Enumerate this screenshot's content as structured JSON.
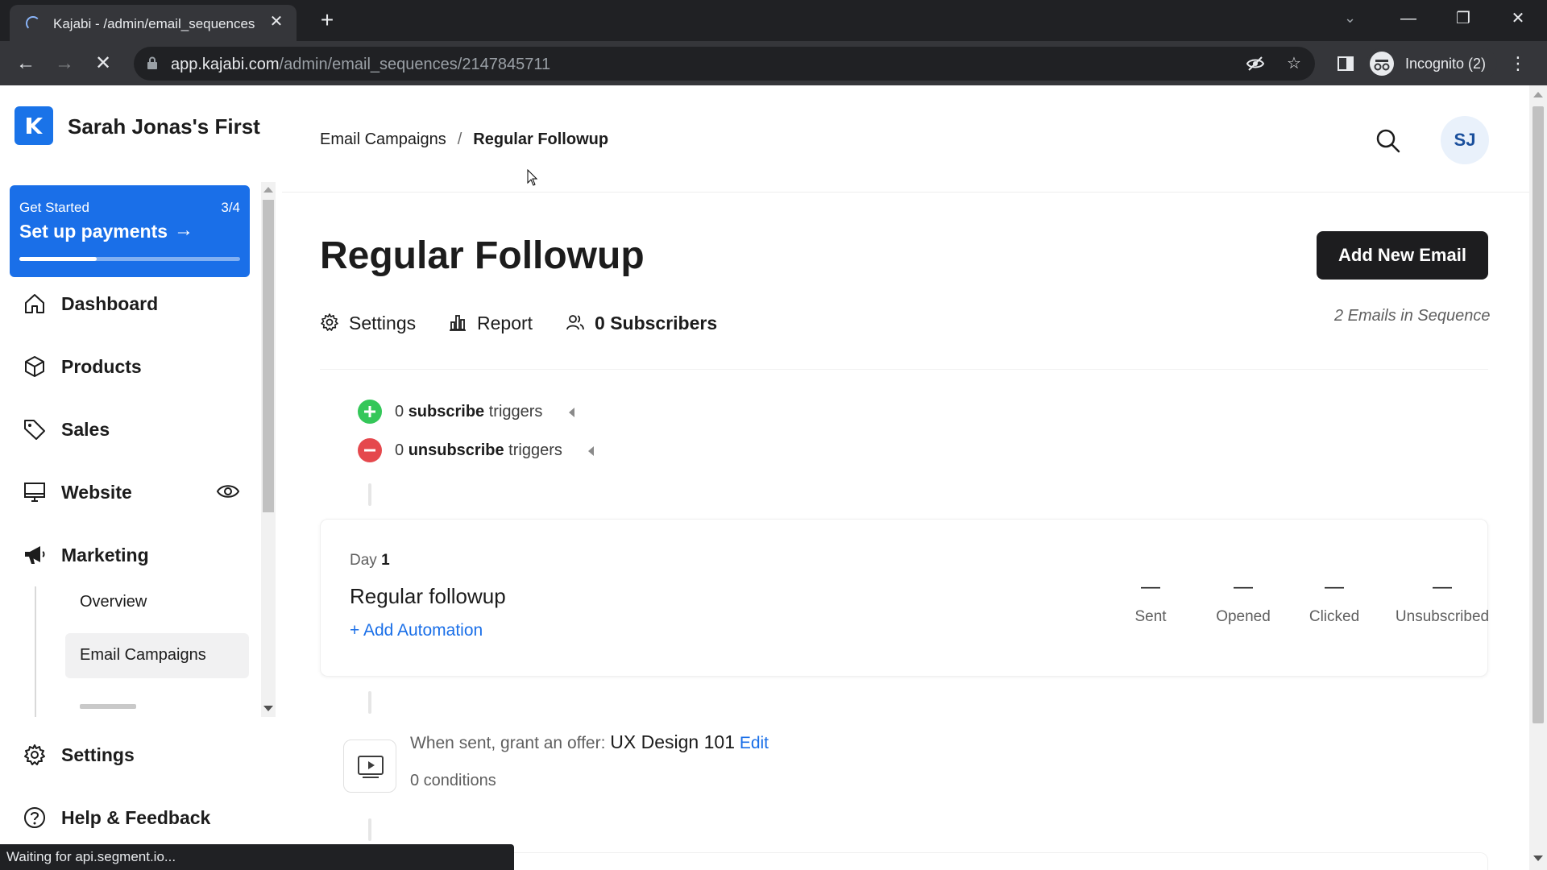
{
  "browser": {
    "tab_title": "Kajabi - /admin/email_sequences",
    "url_host": "app.kajabi.com",
    "url_path": "/admin/email_sequences/2147845711",
    "profile_label": "Incognito (2)",
    "status_text": "Waiting for api.segment.io..."
  },
  "sidebar": {
    "brand_name": "Sarah Jonas's First",
    "get_started": {
      "label": "Get Started",
      "count": "3/4",
      "title": "Set up payments",
      "progress": 0.35
    },
    "nav": [
      {
        "label": "Dashboard",
        "icon": "home-icon"
      },
      {
        "label": "Products",
        "icon": "box-icon"
      },
      {
        "label": "Sales",
        "icon": "tag-icon"
      },
      {
        "label": "Website",
        "icon": "monitor-icon"
      },
      {
        "label": "Marketing",
        "icon": "megaphone-icon"
      },
      {
        "label": "Settings",
        "icon": "gear-icon"
      },
      {
        "label": "Help & Feedback",
        "icon": "help-icon"
      }
    ],
    "marketing_sub": [
      {
        "label": "Overview"
      },
      {
        "label": "Email Campaigns",
        "active": true
      }
    ]
  },
  "header": {
    "breadcrumb_parent": "Email Campaigns",
    "breadcrumb_sep": "/",
    "breadcrumb_current": "Regular Followup",
    "avatar_initials": "SJ"
  },
  "main": {
    "title": "Regular Followup",
    "add_button": "Add New Email",
    "tabs": {
      "settings": "Settings",
      "report": "Report",
      "subscribers_count": "0",
      "subscribers_label": "Subscribers"
    },
    "emails_in_sequence": "2 Emails in Sequence",
    "triggers": {
      "subscribe_count": "0",
      "subscribe_word": "subscribe",
      "subscribe_suffix": "triggers",
      "unsubscribe_count": "0",
      "unsubscribe_word": "unsubscribe",
      "unsubscribe_suffix": "triggers"
    },
    "email": {
      "day_label": "Day",
      "day_number": "1",
      "name": "Regular followup",
      "add_automation": "+ Add Automation",
      "stats": [
        {
          "value": "—",
          "name": "Sent"
        },
        {
          "value": "—",
          "name": "Opened"
        },
        {
          "value": "—",
          "name": "Clicked"
        },
        {
          "value": "—",
          "name": "Unsubscribed"
        }
      ]
    },
    "offer": {
      "prefix": "When sent, grant an offer:",
      "name": "UX Design 101",
      "edit": "Edit",
      "conditions": "0 conditions"
    }
  },
  "colors": {
    "accent": "#1a6fe8",
    "subscribe_green": "#34c759",
    "unsubscribe_red": "#e5484d"
  }
}
